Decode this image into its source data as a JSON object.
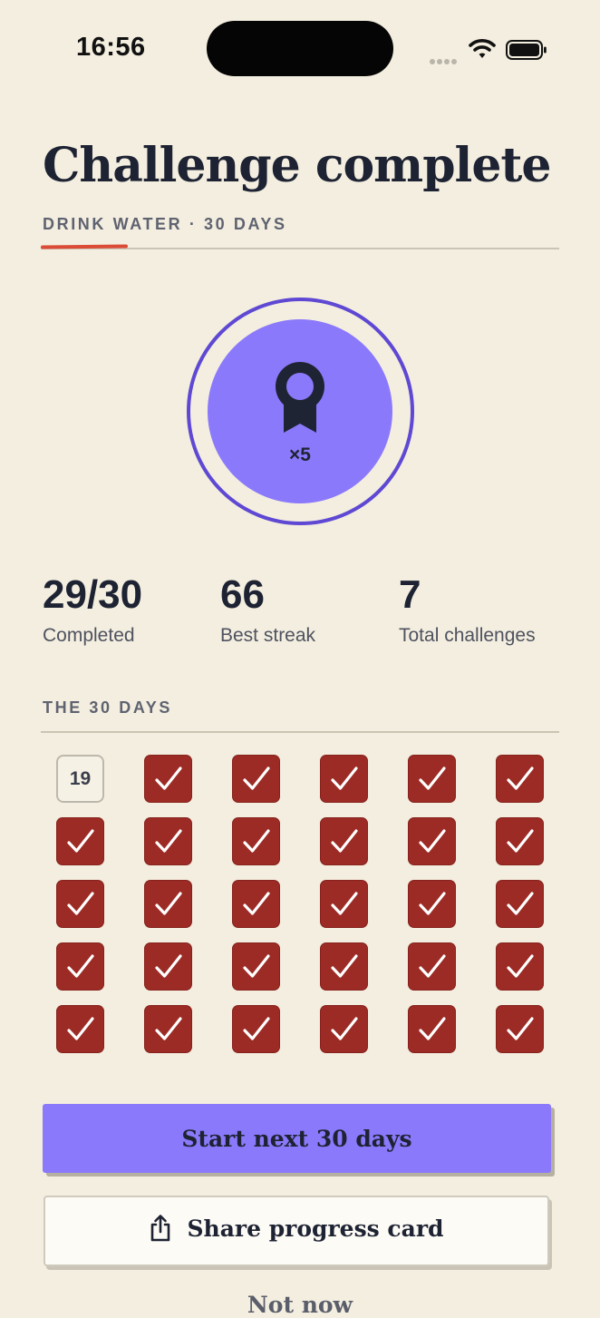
{
  "status_bar": {
    "time": "16:56",
    "icons": [
      "signal-dots-icon",
      "wifi-icon",
      "battery-icon"
    ]
  },
  "header": {
    "title": "Challenge complete",
    "subtitle": "DRINK WATER · 30 DAYS"
  },
  "badge": {
    "icon": "ribbon-award-icon",
    "count_label": "×5"
  },
  "stats": [
    {
      "value": "29/30",
      "label": "Completed"
    },
    {
      "value": "66",
      "label": "Best streak"
    },
    {
      "value": "7",
      "label": "Total challenges"
    }
  ],
  "days": {
    "section_label": "THE 30 DAYS",
    "cells": [
      {
        "state": "pending",
        "label": "19"
      },
      {
        "state": "done"
      },
      {
        "state": "done"
      },
      {
        "state": "done"
      },
      {
        "state": "done"
      },
      {
        "state": "done"
      },
      {
        "state": "done"
      },
      {
        "state": "done"
      },
      {
        "state": "done"
      },
      {
        "state": "done"
      },
      {
        "state": "done"
      },
      {
        "state": "done"
      },
      {
        "state": "done"
      },
      {
        "state": "done"
      },
      {
        "state": "done"
      },
      {
        "state": "done"
      },
      {
        "state": "done"
      },
      {
        "state": "done"
      },
      {
        "state": "done"
      },
      {
        "state": "done"
      },
      {
        "state": "done"
      },
      {
        "state": "done"
      },
      {
        "state": "done"
      },
      {
        "state": "done"
      },
      {
        "state": "done"
      },
      {
        "state": "done"
      },
      {
        "state": "done"
      },
      {
        "state": "done"
      },
      {
        "state": "done"
      },
      {
        "state": "done"
      }
    ]
  },
  "actions": {
    "primary_label": "Start next 30 days",
    "share_label": "Share progress card",
    "share_icon": "share-icon",
    "dismiss_label": "Not now"
  },
  "colors": {
    "background": "#F3EEDF",
    "accent_purple": "#8B79FB",
    "ring_purple": "#5F48D3",
    "done_red": "#9C2B25",
    "title_ink": "#1E2333",
    "underline_red": "#DB4B36"
  }
}
